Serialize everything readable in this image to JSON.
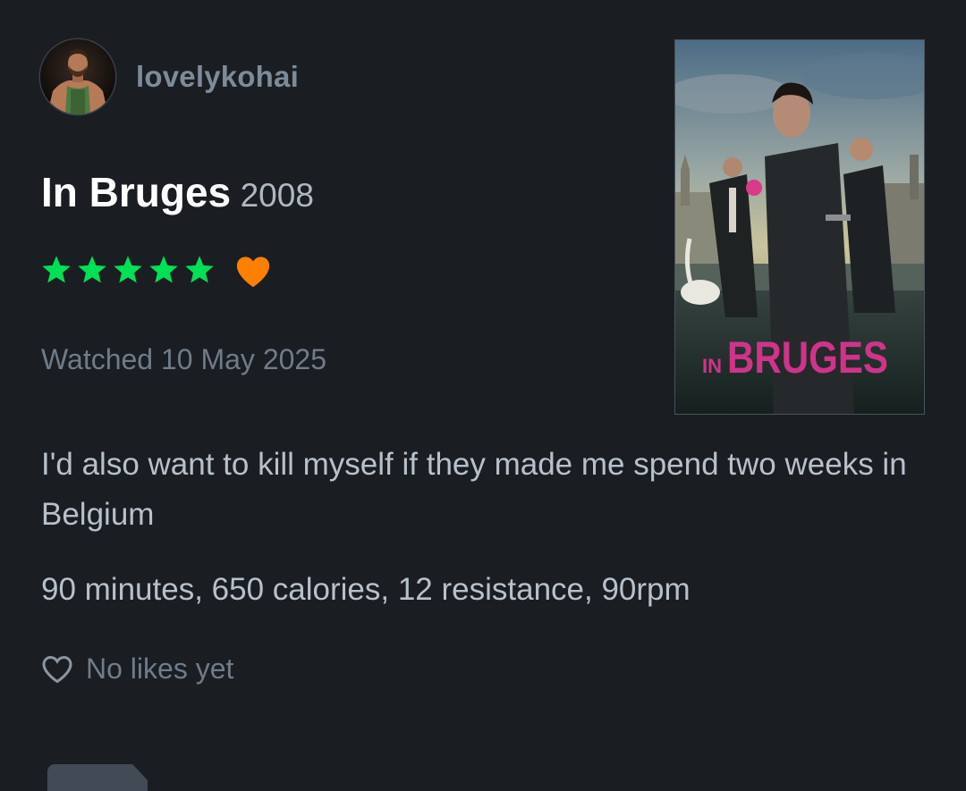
{
  "user": {
    "username": "lovelykohai",
    "avatar_icon": "user-avatar"
  },
  "film": {
    "title": "In Bruges",
    "year": "2008",
    "poster_title": "BRUGES",
    "poster_prefix": "IN"
  },
  "rating": {
    "stars": 5,
    "max_stars": 5,
    "star_color": "#00e054",
    "liked": true,
    "liked_color": "#ff8000"
  },
  "watched": {
    "label": "Watched 10 May 2025"
  },
  "review": {
    "text": "I'd also want to kill myself if they made me spend two weeks in Belgium",
    "stats": "90 minutes, 650 calories, 12 resistance, 90rpm"
  },
  "likes": {
    "text": "No likes yet",
    "icon": "heart-outline-icon"
  }
}
